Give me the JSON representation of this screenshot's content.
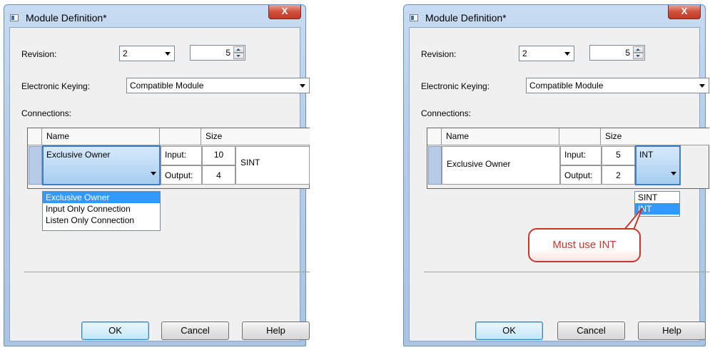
{
  "dialog_left": {
    "title": "Module Definition*",
    "close_label": "X",
    "revision_label": "Revision:",
    "revision_major": "2",
    "revision_minor": "5",
    "keying_label": "Electronic Keying:",
    "keying_value": "Compatible Module",
    "connections_label": "Connections:",
    "col_name": "Name",
    "col_size": "Size",
    "connection_name": "Exclusive Owner",
    "input_label": "Input:",
    "input_size": "10",
    "output_label": "Output:",
    "output_size": "4",
    "data_type": "SINT",
    "dropdown_options": [
      "Exclusive Owner",
      "Input Only Connection",
      "Listen Only Connection"
    ],
    "ok_label": "OK",
    "cancel_label": "Cancel",
    "help_label": "Help"
  },
  "dialog_right": {
    "title": "Module Definition*",
    "close_label": "X",
    "revision_label": "Revision:",
    "revision_major": "2",
    "revision_minor": "5",
    "keying_label": "Electronic Keying:",
    "keying_value": "Compatible Module",
    "connections_label": "Connections:",
    "col_name": "Name",
    "col_size": "Size",
    "connection_name": "Exclusive Owner",
    "input_label": "Input:",
    "input_size": "5",
    "output_label": "Output:",
    "output_size": "2",
    "data_type": "INT",
    "dropdown_options": [
      "SINT",
      "INT"
    ],
    "ok_label": "OK",
    "cancel_label": "Cancel",
    "help_label": "Help"
  },
  "callout": {
    "text": "Must use INT"
  },
  "colors": {
    "titlebar": "#b5cde8",
    "close": "#c03a26",
    "selection": "#3399ff",
    "callout": "#c0392b"
  }
}
